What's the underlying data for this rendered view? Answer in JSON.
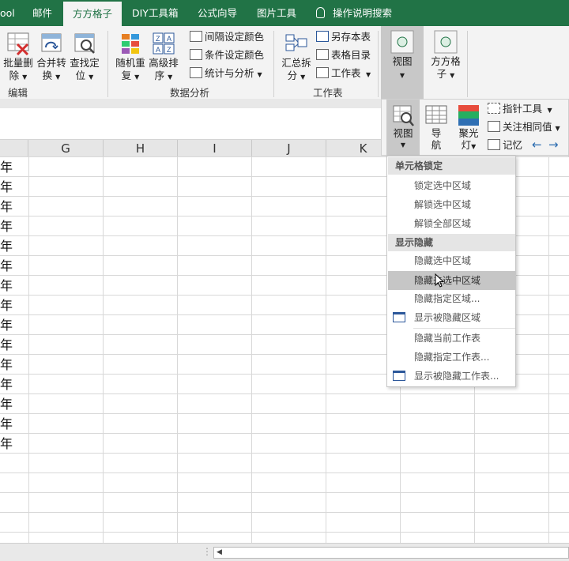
{
  "tabs": [
    "ool",
    "邮件",
    "方方格子",
    "DIY工具箱",
    "公式向导",
    "图片工具",
    "操作说明搜索"
  ],
  "ribbon": {
    "edit_group": {
      "label": "编辑",
      "buttons": [
        {
          "line1": "批量删",
          "line2": "除"
        },
        {
          "line1": "合并转",
          "line2": "换"
        },
        {
          "line1": "查找定",
          "line2": "位"
        }
      ]
    },
    "analysis_group": {
      "label": "数据分析",
      "buttons": [
        {
          "line1": "随机重",
          "line2": "复"
        },
        {
          "line1": "高级排",
          "line2": "序"
        }
      ],
      "small": [
        "间隔设定颜色",
        "条件设定颜色",
        "统计与分析"
      ]
    },
    "sheet_group": {
      "label": "工作表",
      "big": {
        "line1": "汇总拆",
        "line2": "分"
      },
      "small": [
        "另存本表",
        "表格目录",
        "工作表"
      ]
    },
    "view_button": "视图",
    "fangfang_button": {
      "line1": "方方格",
      "line2": "子"
    }
  },
  "flyout": {
    "view": "视图",
    "nav": {
      "line1": "导",
      "line2": "航"
    },
    "spot": {
      "line1": "聚光",
      "line2": "灯"
    },
    "pointer": "指针工具",
    "focus": "关注相同值",
    "memory": "记忆"
  },
  "columns": [
    "G",
    "H",
    "I",
    "J",
    "K"
  ],
  "cells": [
    "年",
    "年",
    "年",
    "年",
    "年",
    "年",
    "年",
    "年",
    "年",
    "年",
    "年",
    "年",
    "年",
    "年",
    "年"
  ],
  "menu": {
    "section1": "单元格锁定",
    "items1": [
      "锁定选中区域",
      "解锁选中区域",
      "解锁全部区域"
    ],
    "section2": "显示隐藏",
    "items2": [
      "隐藏选中区域",
      "隐藏未选中区域",
      "隐藏指定区域...",
      "显示被隐藏区域"
    ],
    "items3": [
      "隐藏当前工作表",
      "隐藏指定工作表...",
      "显示被隐藏工作表..."
    ]
  },
  "colors": {
    "brand": "#217346",
    "hover": "#c6c6c6"
  }
}
